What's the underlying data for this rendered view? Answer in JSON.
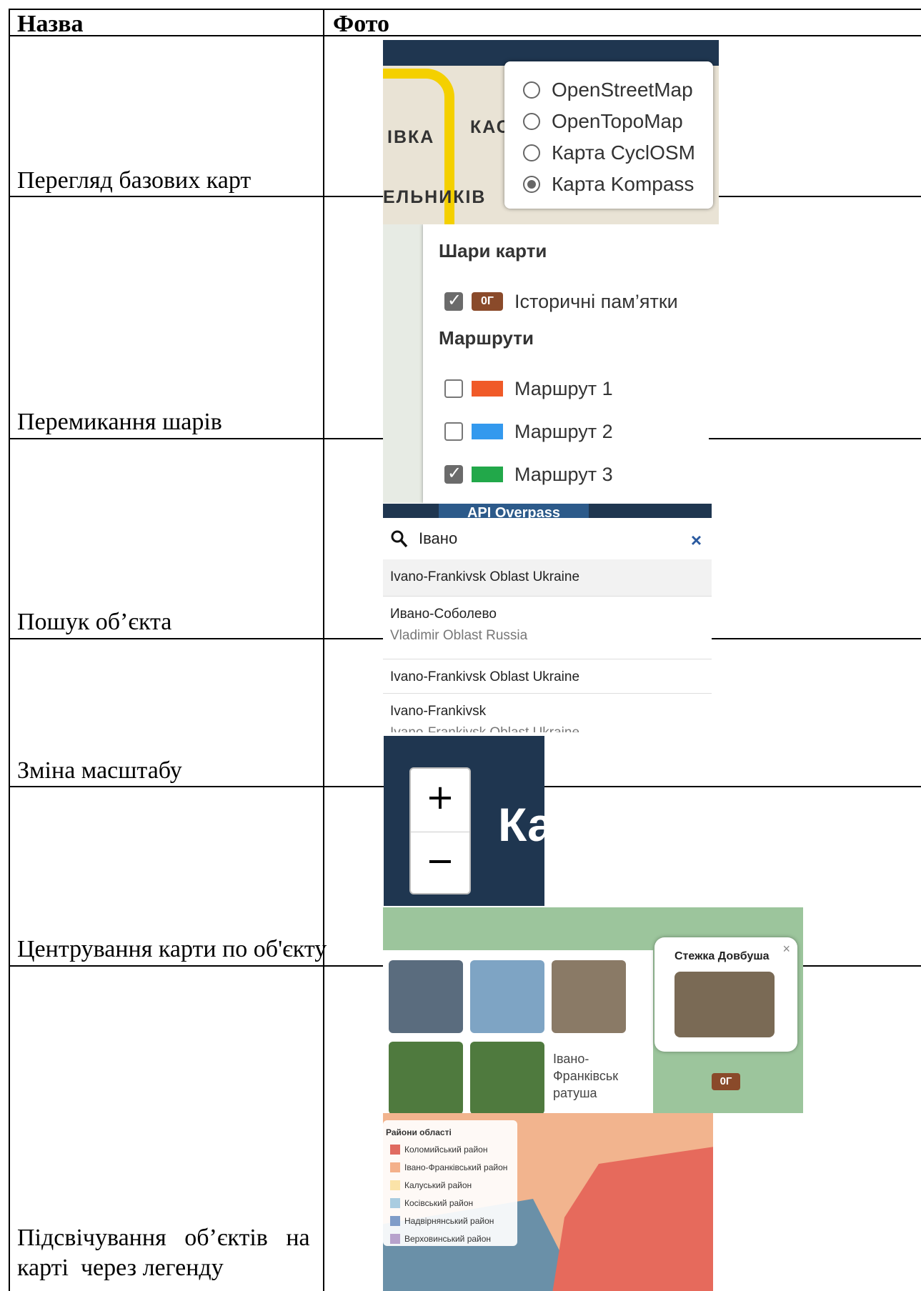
{
  "table": {
    "header": {
      "col_name": "Назва",
      "col_photo": "Фото"
    },
    "rows": [
      {
        "name": "Перегляд базових карт"
      },
      {
        "name": "Перемикання шарів"
      },
      {
        "name": "Пошук об’єкта"
      },
      {
        "name": "Зміна масштабу"
      },
      {
        "name": "Центрування карти по об'єкту"
      },
      {
        "name_line1": "Підсвічування   об’єктів   на",
        "name_line2": "карті  через легенду"
      }
    ]
  },
  "shots": {
    "basemaps": {
      "map_labels": [
        "ІВКА",
        "КАС",
        "ЕЛЬНИКІВ"
      ],
      "options": [
        {
          "label": "OpenStreetMap",
          "selected": false
        },
        {
          "label": "OpenTopoMap",
          "selected": false
        },
        {
          "label": "Карта CyclOSM",
          "selected": false
        },
        {
          "label": "Карта Kompass",
          "selected": true
        }
      ]
    },
    "layers": {
      "heading_layers": "Шари карти",
      "historic_label": "Історичні пам’ятки",
      "historic_checked": true,
      "heading_routes": "Маршрути",
      "routes": [
        {
          "label": "Маршрут 1",
          "color": "#f05a28",
          "checked": false
        },
        {
          "label": "Маршрут 2",
          "color": "#3399ee",
          "checked": false
        },
        {
          "label": "Маршрут 3",
          "color": "#22a84a",
          "checked": true
        }
      ]
    },
    "search": {
      "tab_label": "API Overpass",
      "query": "Івано",
      "close_glyph": "×",
      "results": [
        {
          "title": "Ivano-Frankivsk Oblast Ukraine",
          "sub": ""
        },
        {
          "title": "Ивано-Соболево",
          "sub": "Vladimir Oblast Russia"
        },
        {
          "title": "Ivano-Frankivsk Oblast Ukraine",
          "sub": ""
        },
        {
          "title": "Ivano-Frankivsk",
          "sub": "Ivano-Frankivsk Oblast Ukraine"
        }
      ]
    },
    "zoom": {
      "plus": "+",
      "minus": "−",
      "title_fragment": "Ка"
    },
    "center": {
      "popup_title": "Стежка Довбуша",
      "popup_close": "×",
      "broken_image_alt": "Івано-Франківськ ратуша",
      "marker_glyph": "0Г"
    },
    "legend": {
      "title": "Райони області",
      "items": [
        {
          "label": "Коломийський район",
          "color": "#e06a60"
        },
        {
          "label": "Івано-Франківський район",
          "color": "#f4b08a"
        },
        {
          "label": "Калуський район",
          "color": "#fbe3a8"
        },
        {
          "label": "Косівський район",
          "color": "#a9cce0"
        },
        {
          "label": "Надвірнянський район",
          "color": "#7f9cc8"
        },
        {
          "label": "Верховинський район",
          "color": "#b7a2cc"
        }
      ]
    }
  }
}
